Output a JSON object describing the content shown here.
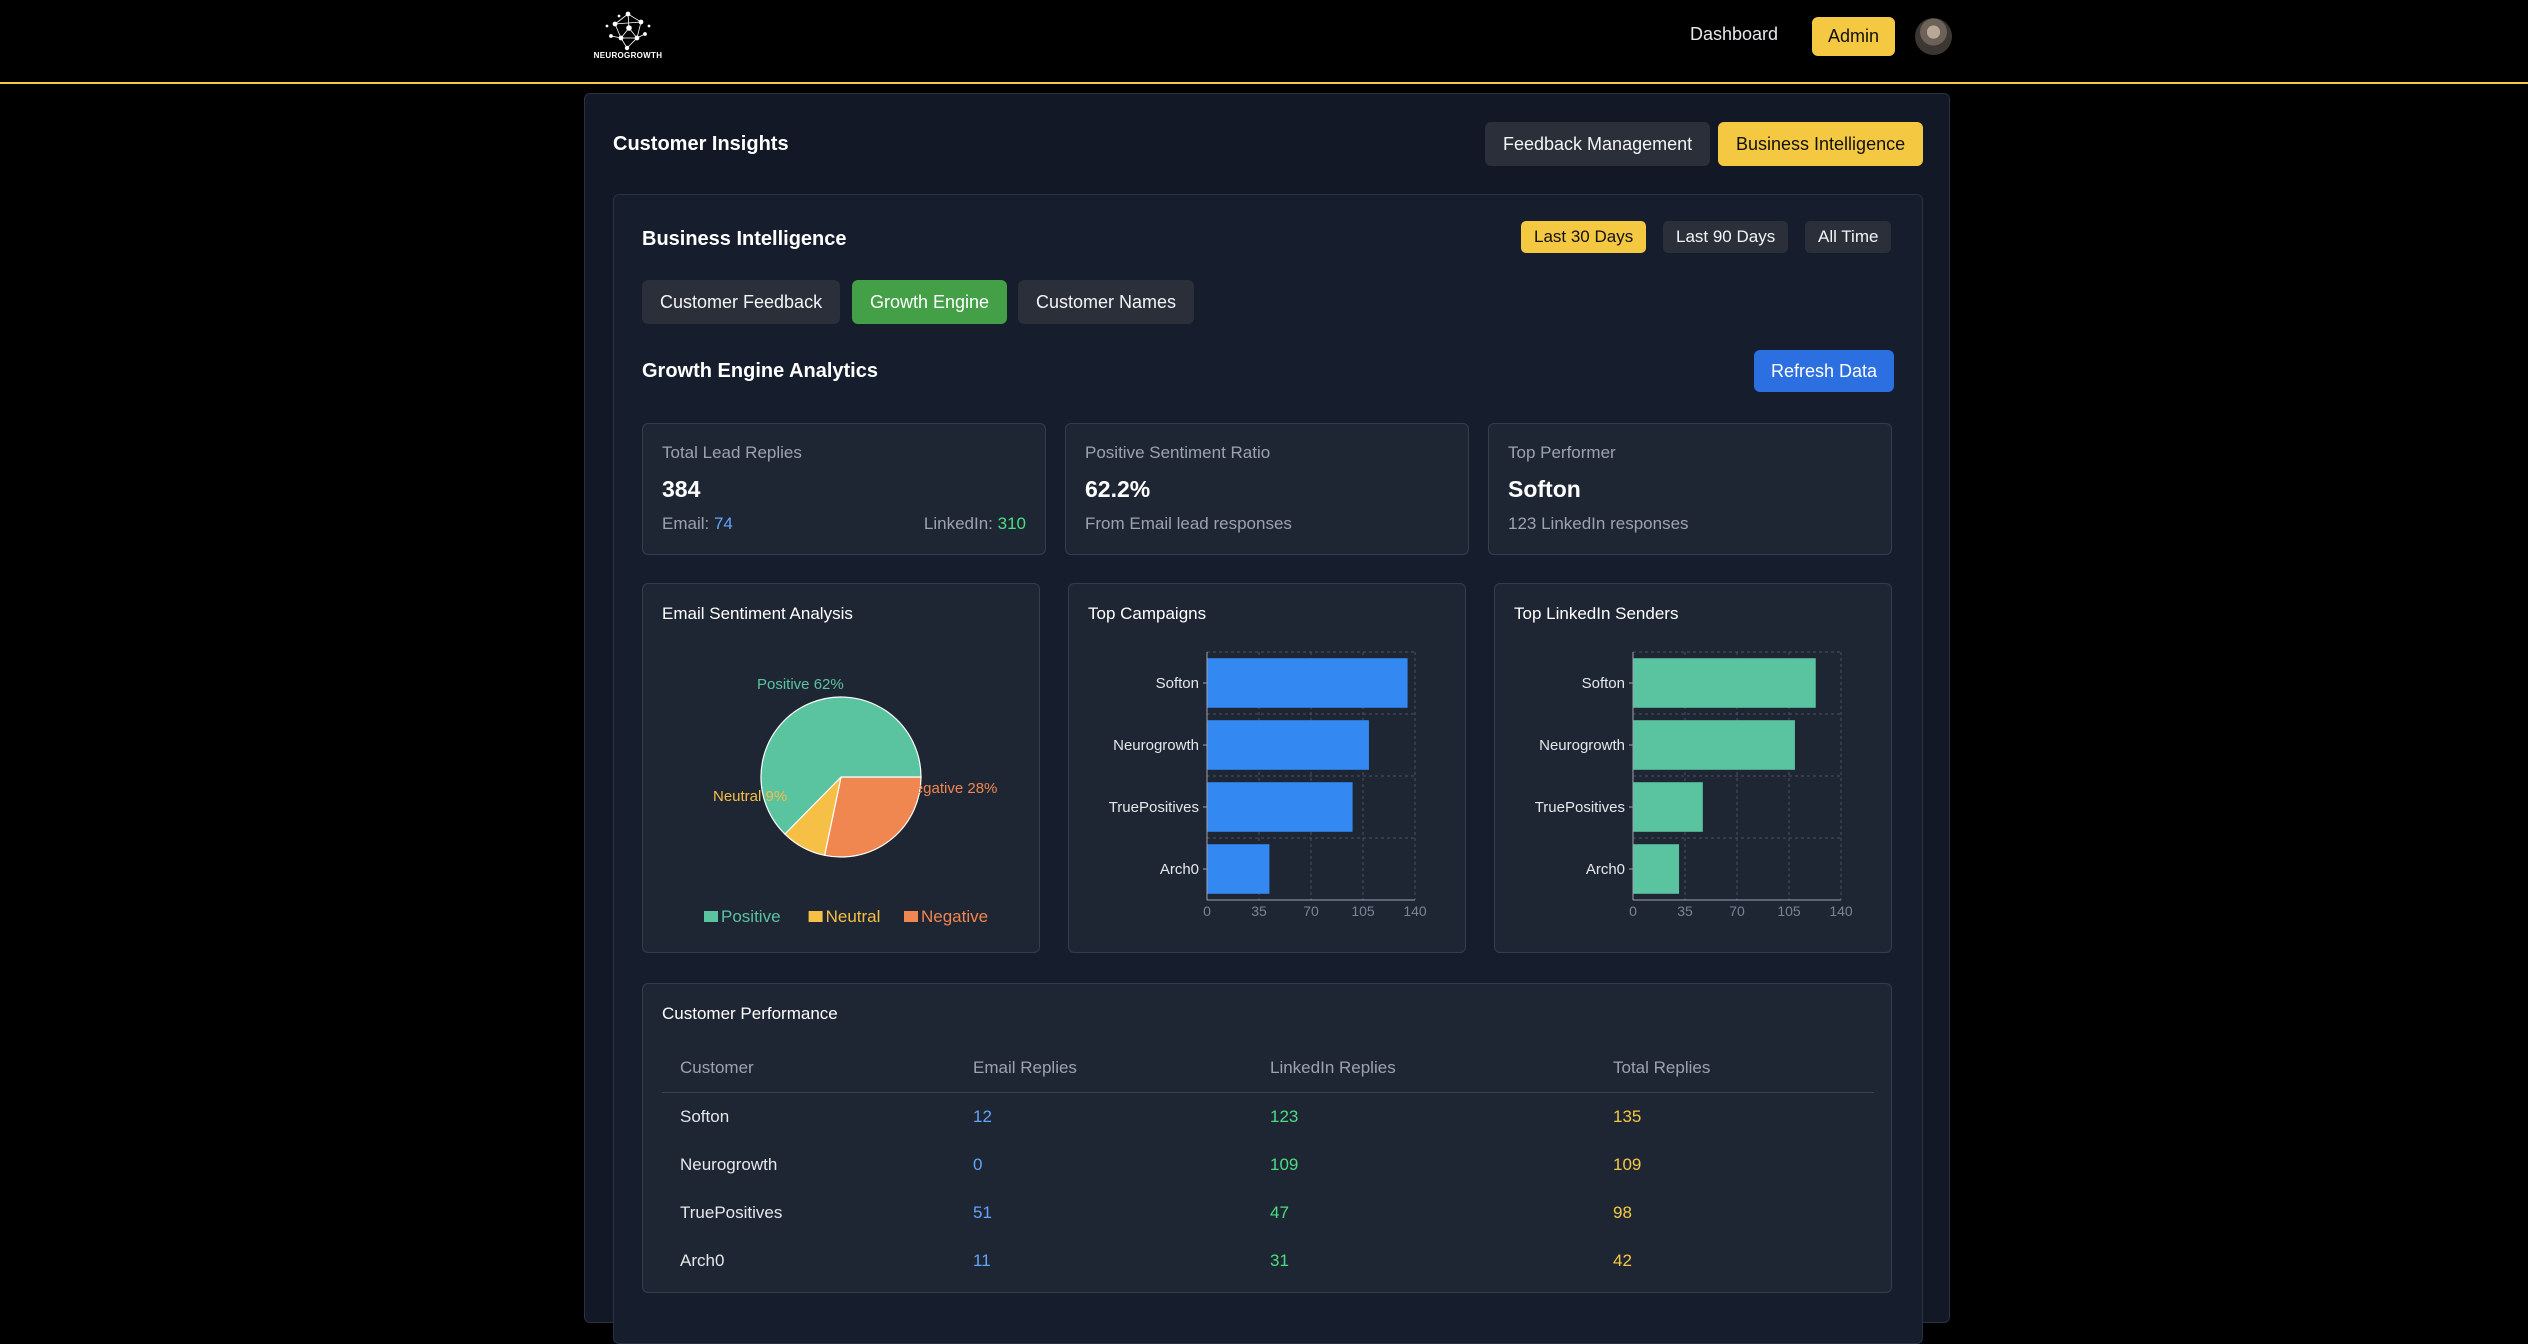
{
  "header": {
    "logo_text": "NEUROGROWTH",
    "nav_dashboard": "Dashboard",
    "nav_admin": "Admin"
  },
  "panel": {
    "title": "Customer Insights",
    "tabs": [
      {
        "label": "Feedback Management",
        "active": false
      },
      {
        "label": "Business Intelligence",
        "active": true
      }
    ]
  },
  "bi": {
    "title": "Business Intelligence",
    "ranges": [
      {
        "label": "Last 30 Days",
        "active": true
      },
      {
        "label": "Last 90 Days",
        "active": false
      },
      {
        "label": "All Time",
        "active": false
      }
    ],
    "subtabs": [
      {
        "label": "Customer Feedback",
        "active": false
      },
      {
        "label": "Growth Engine",
        "active": true
      },
      {
        "label": "Customer Names",
        "active": false
      }
    ],
    "section_title": "Growth Engine Analytics",
    "refresh_label": "Refresh Data"
  },
  "stats": [
    {
      "label": "Total Lead Replies",
      "value": "384",
      "email_label": "Email:",
      "email_value": "74",
      "linkedin_label": "LinkedIn:",
      "linkedin_value": "310"
    },
    {
      "label": "Positive Sentiment Ratio",
      "value": "62.2%",
      "sub": "From Email lead responses"
    },
    {
      "label": "Top Performer",
      "value": "Softon",
      "sub": "123 LinkedIn responses"
    }
  ],
  "colors": {
    "accent": "#f5c842",
    "positive": "#5ac3a0",
    "neutral": "#f6bf46",
    "negative": "#f08650",
    "campaign_bar": "#3388f2",
    "sender_bar": "#5ac3a0",
    "email_text": "#60a5fa",
    "linkedin_text": "#4ade80",
    "total_text": "#f5c842"
  },
  "chart_data": [
    {
      "type": "pie",
      "title": "Email Sentiment Analysis",
      "categories": [
        "Positive",
        "Neutral",
        "Negative"
      ],
      "values": [
        62,
        9,
        28
      ],
      "slice_labels": [
        "Positive 62%",
        "Neutral 9%",
        "Negative 28%"
      ],
      "legend": "bottom"
    },
    {
      "type": "bar",
      "orientation": "horizontal",
      "title": "Top Campaigns",
      "categories": [
        "Softon",
        "Neurogrowth",
        "TruePositives",
        "Arch0"
      ],
      "values": [
        135,
        109,
        98,
        42
      ],
      "xlim": [
        0,
        140
      ],
      "xticks": [
        "0",
        "35",
        "70",
        "105",
        "140"
      ],
      "grid": true
    },
    {
      "type": "bar",
      "orientation": "horizontal",
      "title": "Top LinkedIn Senders",
      "categories": [
        "Softon",
        "Neurogrowth",
        "TruePositives",
        "Arch0"
      ],
      "values": [
        123,
        109,
        47,
        31
      ],
      "xlim": [
        0,
        140
      ],
      "xticks": [
        "0",
        "35",
        "70",
        "105",
        "140"
      ],
      "grid": true
    }
  ],
  "table": {
    "title": "Customer Performance",
    "columns": [
      "Customer",
      "Email Replies",
      "LinkedIn Replies",
      "Total Replies"
    ],
    "rows": [
      [
        "Softon",
        "12",
        "123",
        "135"
      ],
      [
        "Neurogrowth",
        "0",
        "109",
        "109"
      ],
      [
        "TruePositives",
        "51",
        "47",
        "98"
      ],
      [
        "Arch0",
        "11",
        "31",
        "42"
      ]
    ]
  }
}
